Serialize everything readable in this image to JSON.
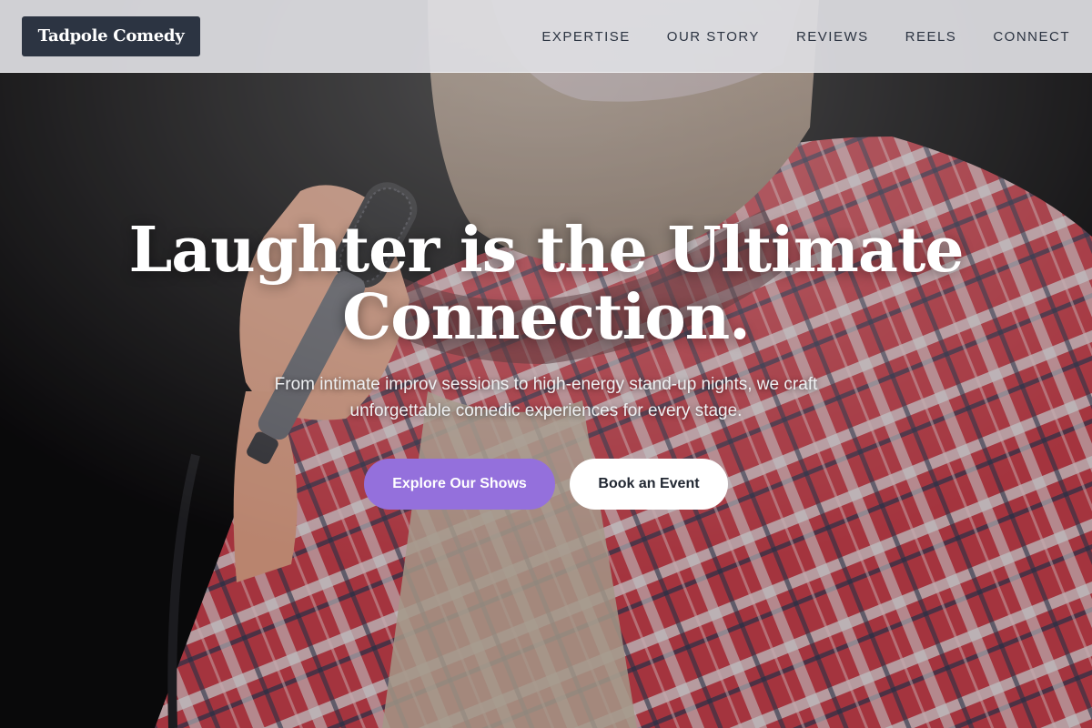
{
  "header": {
    "brand": "Tadpole Comedy",
    "nav": [
      "EXPERTISE",
      "OUR STORY",
      "REVIEWS",
      "REELS",
      "CONNECT"
    ]
  },
  "hero": {
    "headline": "Laughter is the Ultimate Connection.",
    "subtitle": "From intimate improv sessions to high-energy stand-up nights, we craft unforgettable comedic experiences for every stage.",
    "primary_button": "Explore Our Shows",
    "secondary_button": "Book an Event",
    "background_image": "comedian-with-microphone-photo"
  },
  "colors": {
    "nav_bg": "#dedee2",
    "brand_bg": "#2c3442",
    "primary_accent": "#9470dc",
    "headline_text": "#ffffff"
  }
}
